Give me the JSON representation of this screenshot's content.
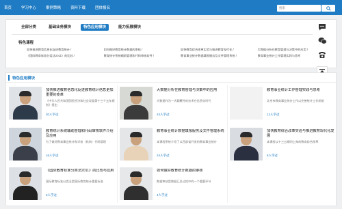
{
  "nav": {
    "items": [
      "首页",
      "学习中心",
      "案例策略",
      "资料下载",
      "团体报名"
    ],
    "search_placeholder": "搜索"
  },
  "filter": {
    "tabs": [
      {
        "label": "全部分类",
        "active": false
      },
      {
        "label": "基础业务模块",
        "active": false
      },
      {
        "label": "特色应用模块",
        "active": true
      },
      {
        "label": "能力拓展模块",
        "active": false
      }
    ],
    "special_title": "特色课程",
    "course_links": [
      "加快推进教育信息化促进教育统计 /",
      "如何做好教育统计数据的审核 /",
      "加快教育综合改革实验与推进教育现代化 /",
      "大数据分析在教育管理与决策中的应用 /",
      "《国际教育标准分类法2011》的比较 /",
      "教育统计系统辅助管理和代码审核软件 /",
      "教育事业统计数据填报服务及文件管理系统 /",
      "教育事业统计工作管理实践与思考"
    ]
  },
  "side": {
    "icons": [
      "chat-icon",
      "wechat-icon",
      "phone-icon",
      "back-to-top-icon"
    ]
  },
  "panel": {
    "title": "特色应用模块",
    "courses": [
      {
        "title": "加快推进教育信息化促进教育统计信息更加重要的变革",
        "desc": "《中华人民共和国国民经济和社会发展第十三个五年规划》提出",
        "count": "30人学过"
      },
      {
        "title": "大数据分析在教育管理与决策中的应用",
        "desc": "大数据作为一大颠覆性的技术在信息化时代",
        "count": "24人学过"
      },
      {
        "title": "教育事业统计工作管理实践与思考",
        "desc": "北京市教育事业统计工作以完善统计工作机制",
        "count": "12人学过"
      },
      {
        "title": "教育统计系统辅助管理和代码审核软件介绍及应用",
        "desc": "为了做好教育事业统计和学校（机构）代码管理",
        "count": "16人学过"
      },
      {
        "title": "教育事业统计数据填报服务及文件管理系统",
        "desc": "本课程系统介绍了以西部省开发的教育事业统计",
        "count": "24人学过"
      },
      {
        "title": "加快教育综合改革实验与推进教育现代化发展",
        "desc": "本课程以十三五期间上海的教育综合改革",
        "count": "6人学过"
      },
      {
        "title": "《国际教育标准分类法2011》的比较与应用",
        "desc": "国际教育标准分类法是国际教育统计重要标准",
        "count": "5人学过"
      },
      {
        "title": "如何做好教育统计数据的审核",
        "desc": "数据审核是数据汇总过程中的一个重要环节",
        "count": "4人学过"
      }
    ]
  }
}
